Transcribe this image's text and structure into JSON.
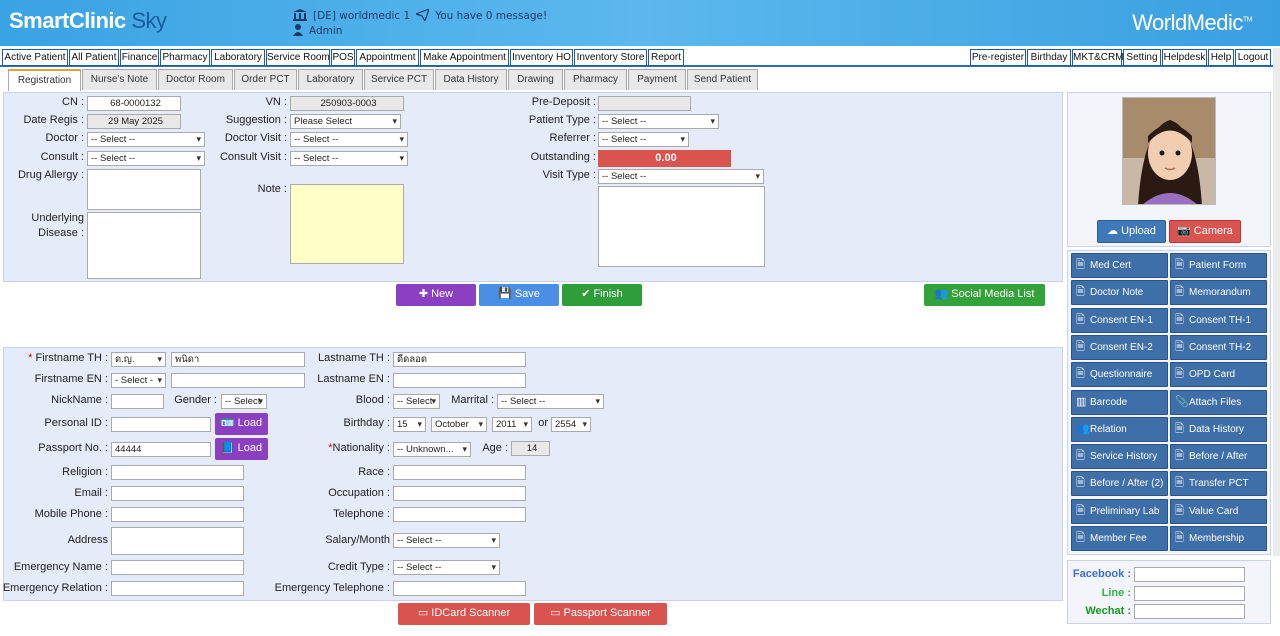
{
  "header": {
    "logo_main": "SmartClinic",
    "logo_sky": " Sky",
    "clinic": "[DE] worldmedic 1",
    "messages": "You have 0 message!",
    "user": "Admin",
    "brand": "WorldMedic",
    "brand_tm": "TM"
  },
  "menu_left": [
    "Active Patient",
    "All Patient",
    "Finance",
    "Pharmacy",
    "Laboratory",
    "Service Room",
    "POS",
    "Appointment",
    "Make Appointment",
    "Inventory HO",
    "Inventory Store",
    "Report"
  ],
  "menu_right": [
    "Pre-register",
    "Birthday",
    "MKT&CRM",
    "Setting",
    "Helpdesk",
    "Help",
    "Logout"
  ],
  "tabs": [
    "Registration",
    "Nurse's Note",
    "Doctor Room",
    "Order PCT",
    "Laboratory",
    "Service PCT",
    "Data History",
    "Drawing",
    "Pharmacy",
    "Payment",
    "Send Patient"
  ],
  "visit": {
    "cn_label": "CN :",
    "cn": "68-0000132",
    "date_label": "Date Regis :",
    "date": "29 May 2025",
    "doctor_label": "Doctor :",
    "doctor": "-- Select --",
    "consult_label": "Consult :",
    "consult": "-- Select --",
    "allergy_label": "Drug Allergy :",
    "underlying_label1": "Underlying",
    "underlying_label2": "Disease :",
    "vn_label": "VN :",
    "vn": "250903-0003",
    "suggestion_label": "Suggestion :",
    "suggestion": "Please Select",
    "doctor_visit_label": "Doctor Visit :",
    "doctor_visit": "-- Select --",
    "consult_visit_label": "Consult Visit :",
    "consult_visit": "-- Select --",
    "note_label": "Note :",
    "predeposit_label": "Pre-Deposit :",
    "predeposit": "",
    "patient_type_label": "Patient Type :",
    "patient_type": "-- Select --",
    "referrer_label": "Referrer :",
    "referrer": "-- Select --",
    "outstanding_label": "Outstanding :",
    "outstanding": "0.00",
    "visit_type_label": "Visit Type :",
    "visit_type": "-- Select --"
  },
  "actions": {
    "new": "New",
    "save": "Save",
    "finish": "Finish",
    "social": "Social Media List"
  },
  "patient": {
    "fname_th_label": "Firstname TH :",
    "title_th": "ด.ญ.",
    "fname_th": "พนิดา",
    "lname_th_label": "Lastname TH :",
    "lname_th": "ดีดลอด",
    "fname_en_label": "Firstname EN :",
    "title_en": "- Select -",
    "fname_en": "",
    "lname_en_label": "Lastname EN :",
    "lname_en": "",
    "nick_label": "NickName :",
    "nick": "",
    "gender_label": "Gender :",
    "gender": "-- Select",
    "blood_label": "Blood :",
    "blood": "-- Select",
    "marital_label": "Marrital :",
    "marital": "-- Select --",
    "pid_label": "Personal ID :",
    "pid": "",
    "load": "Load",
    "birthday_label": "Birthday :",
    "bday": "15",
    "bmonth": "October",
    "byear": "2011",
    "or": "or",
    "byear_th": "2554",
    "passport_label": "Passport No. :",
    "passport": "44444",
    "nationality_label": "Nationality :",
    "nationality": "-- Unknown...",
    "age_label": "Age :",
    "age": "14",
    "religion_label": "Religion :",
    "race_label": "Race :",
    "email_label": "Email :",
    "occupation_label": "Occupation :",
    "mobile_label": "Mobile Phone :",
    "telephone_label": "Telephone :",
    "address_label": "Address",
    "salary_label": "Salary/Month",
    "salary": "-- Select --",
    "emg_name_label": "Emergency Name :",
    "credit_label": "Credit Type :",
    "credit": "-- Select --",
    "emg_rel_label": "Emergency Relation :",
    "emg_tel_label": "Emergency Telephone :"
  },
  "scanners": {
    "idcard": "IDCard Scanner",
    "passport": "Passport Scanner"
  },
  "photo": {
    "upload": "Upload",
    "camera": "Camera"
  },
  "side_buttons": [
    "Med Cert",
    "Patient Form",
    "Doctor Note",
    "Memorandum",
    "Consent EN-1",
    "Consent TH-1",
    "Consent EN-2",
    "Consent TH-2",
    "Questionnaire",
    "OPD Card",
    "Barcode",
    "Attach Files",
    "Relation",
    "Data History",
    "Service History",
    "Before / After",
    "Before / After (2)",
    "Transfer PCT",
    "Preliminary Lab",
    "Value Card",
    "Member Fee",
    "Membership"
  ],
  "social": {
    "facebook": "Facebook :",
    "line": "Line :",
    "wechat": "Wechat :"
  },
  "colors": {
    "header": "#4aaee8",
    "purple": "#8b3fc1",
    "blue": "#4a8ee6",
    "green": "#2f9e3a",
    "social_green": "#34a23b",
    "red": "#d9534f",
    "side_btn": "#3f6fa8",
    "facebook": "#3b6fd0",
    "line": "#2fb54a",
    "wechat": "#1a9a22"
  }
}
